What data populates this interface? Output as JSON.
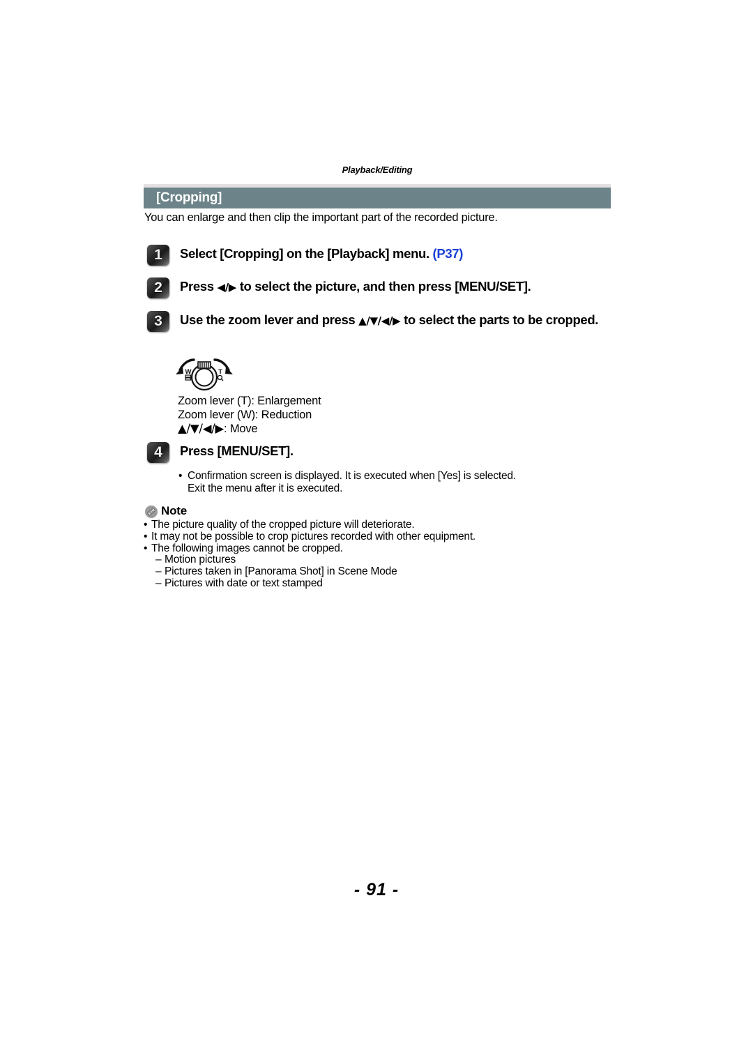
{
  "document": {
    "running_head": "Playback/Editing",
    "page_number": "- 91 -"
  },
  "section": {
    "title": "[Cropping]",
    "title_bar_color": "#6c8489",
    "intro": "You can enlarge and then clip the important part of the recorded picture."
  },
  "steps": [
    {
      "number": "1",
      "text_before": "Select [Cropping] on the [Playback] menu. ",
      "page_ref": "(P37)",
      "text_after": ""
    },
    {
      "number": "2",
      "text_before": "Press ",
      "glyphs": "◀/▶",
      "text_after": " to select the picture, and then press [MENU/SET]."
    },
    {
      "number": "3",
      "text_before": "Use the zoom lever and press ",
      "glyphs": "▲/▼/◀/▶",
      "text_after": " to select the parts to be cropped."
    },
    {
      "number": "4",
      "text_before": "Press [MENU/SET].",
      "glyphs": "",
      "text_after": ""
    }
  ],
  "figure": {
    "name": "zoom-lever-dial",
    "label_wide": "W",
    "label_tele": "T",
    "caption_lines": [
      "Zoom lever (T): Enlargement",
      "Zoom lever (W): Reduction"
    ],
    "caption_move_glyphs": "▲/▼/◀/▶",
    "caption_move_text": ": Move"
  },
  "step4_bullets": [
    {
      "bullet": "•",
      "line1": "Confirmation screen is displayed. It is executed when [Yes] is selected.",
      "line2": "Exit the menu after it is executed."
    }
  ],
  "note": {
    "label": "Note",
    "icon": "pencil-note-icon",
    "bullets": [
      {
        "bullet": "•",
        "text": "The picture quality of the cropped picture will deteriorate."
      },
      {
        "bullet": "•",
        "text": "It may not be possible to crop pictures recorded with other equipment."
      },
      {
        "bullet": "•",
        "text": "The following images cannot be cropped."
      }
    ],
    "sub_items": [
      {
        "dash": "–",
        "text": "Motion pictures"
      },
      {
        "dash": "–",
        "text": "Pictures taken in [Panorama Shot] in Scene Mode"
      },
      {
        "dash": "–",
        "text": "Pictures with date or text stamped"
      }
    ]
  },
  "colors": {
    "link": "#1a3fd4",
    "bar": "#6c8489",
    "strip": "#e2e0e0"
  }
}
